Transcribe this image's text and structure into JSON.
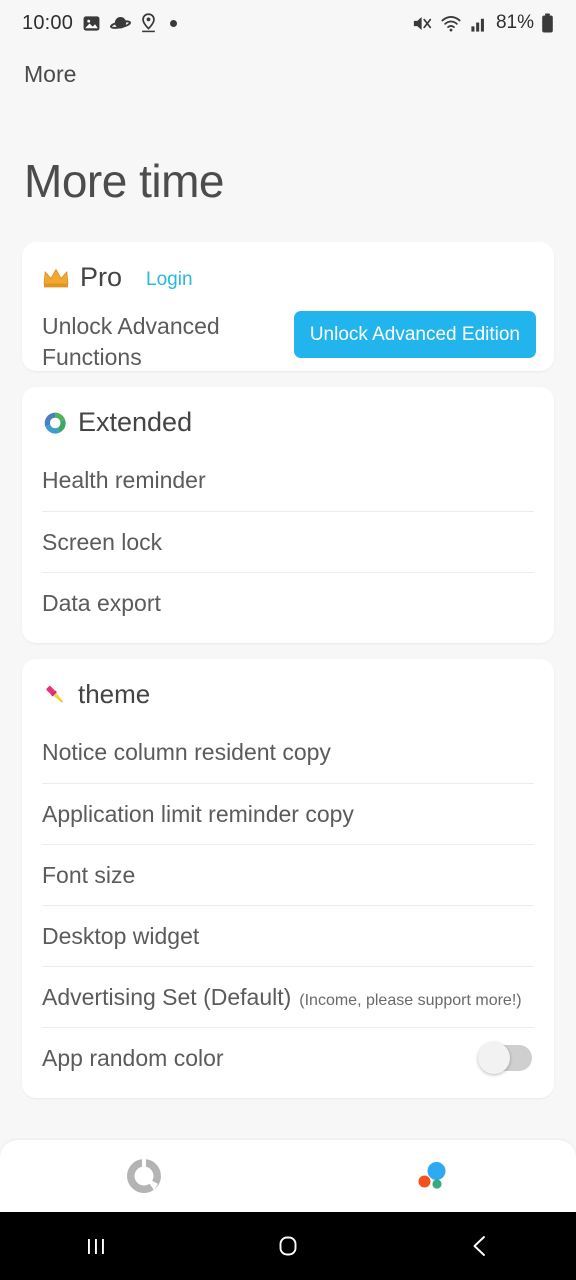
{
  "status_bar": {
    "time": "10:00",
    "left_icons": [
      "image-icon",
      "saturn-icon",
      "location-pin-icon",
      "dot-icon"
    ],
    "right_icons": [
      "mute-icon",
      "wifi-icon",
      "signal-icon"
    ],
    "battery_percent": "81%",
    "battery_icon": "battery-icon"
  },
  "toolbar": {
    "title": "More"
  },
  "header": {
    "title": "More time"
  },
  "pro_card": {
    "icon": "crown-icon",
    "title": "Pro",
    "login_label": "Login",
    "description": "Unlock Advanced Functions",
    "button_label": "Unlock Advanced Edition",
    "button_color": "#22b4ec",
    "link_color": "#2bb8e0"
  },
  "extended_card": {
    "icon": "recycle-icon",
    "title": "Extended",
    "items": [
      {
        "label": "Health reminder"
      },
      {
        "label": "Screen lock"
      },
      {
        "label": "Data export"
      }
    ]
  },
  "theme_card": {
    "icon": "paintbrush-icon",
    "title": "theme",
    "items": [
      {
        "label": "Notice column resident copy",
        "sub": ""
      },
      {
        "label": "Application limit reminder copy",
        "sub": ""
      },
      {
        "label": "Font size",
        "sub": ""
      },
      {
        "label": "Desktop widget",
        "sub": ""
      },
      {
        "label": "Advertising Set (Default)",
        "sub": "(Income, please support more!)"
      },
      {
        "label": "App random color",
        "sub": "",
        "toggle": "off"
      }
    ]
  },
  "bottom_nav": {
    "items": [
      {
        "icon": "donut-chart-icon",
        "active": false
      },
      {
        "icon": "bubbles-icon",
        "active": true
      }
    ]
  },
  "android_nav": {
    "items": [
      {
        "icon": "recents-icon"
      },
      {
        "icon": "home-icon"
      },
      {
        "icon": "back-icon"
      }
    ]
  }
}
